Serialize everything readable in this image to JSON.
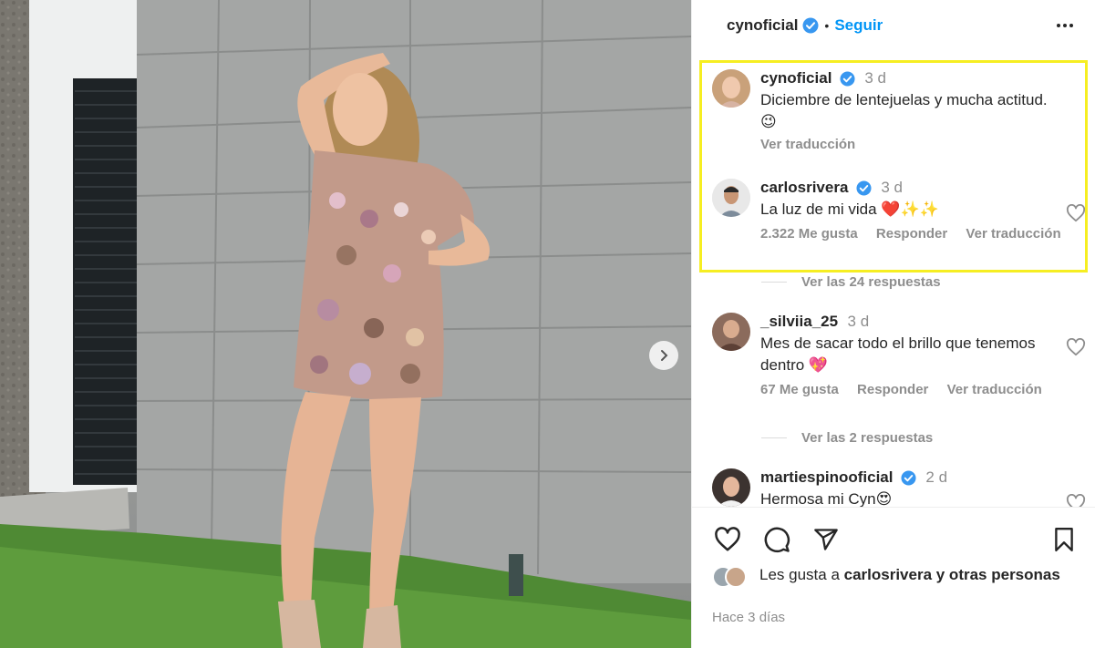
{
  "post": {
    "username": "cynoficial",
    "follow_label": "Seguir",
    "separator": "•",
    "next_label": "›"
  },
  "comments": [
    {
      "username": "cynoficial",
      "time": "3 d",
      "text": "Diciembre de lentejuelas y mucha actitud. 😉",
      "translate_label": "Ver traducción"
    },
    {
      "username": "carlosrivera",
      "time": "3 d",
      "text": "La luz de mi vida ❤️✨✨",
      "likes": "2.322 Me gusta",
      "reply_label": "Responder",
      "translate_label": "Ver traducción",
      "replies_label": "Ver las 24 respuestas"
    },
    {
      "username": "_silviia_25",
      "time": "3 d",
      "text": "Mes de sacar todo el brillo que tenemos dentro 💖",
      "likes": "67 Me gusta",
      "reply_label": "Responder",
      "translate_label": "Ver traducción",
      "replies_label": "Ver las 2 respuestas"
    },
    {
      "username": "martiespinooficial",
      "time": "2 d",
      "text": "Hermosa mi Cyn😍"
    }
  ],
  "footer": {
    "likes_prefix": "Les gusta a ",
    "likes_user": "carlosrivera",
    "likes_suffix": " y otras personas",
    "time_ago": "Hace 3 días"
  },
  "colors": {
    "accent": "#0095f6",
    "verified": "#3897f0",
    "highlight": "#f6ee22",
    "muted": "#8e8e8e"
  },
  "icons": [
    "more-options-icon",
    "verified-icon",
    "heart-icon",
    "comment-icon",
    "share-icon",
    "bookmark-icon",
    "chevron-right-icon"
  ]
}
